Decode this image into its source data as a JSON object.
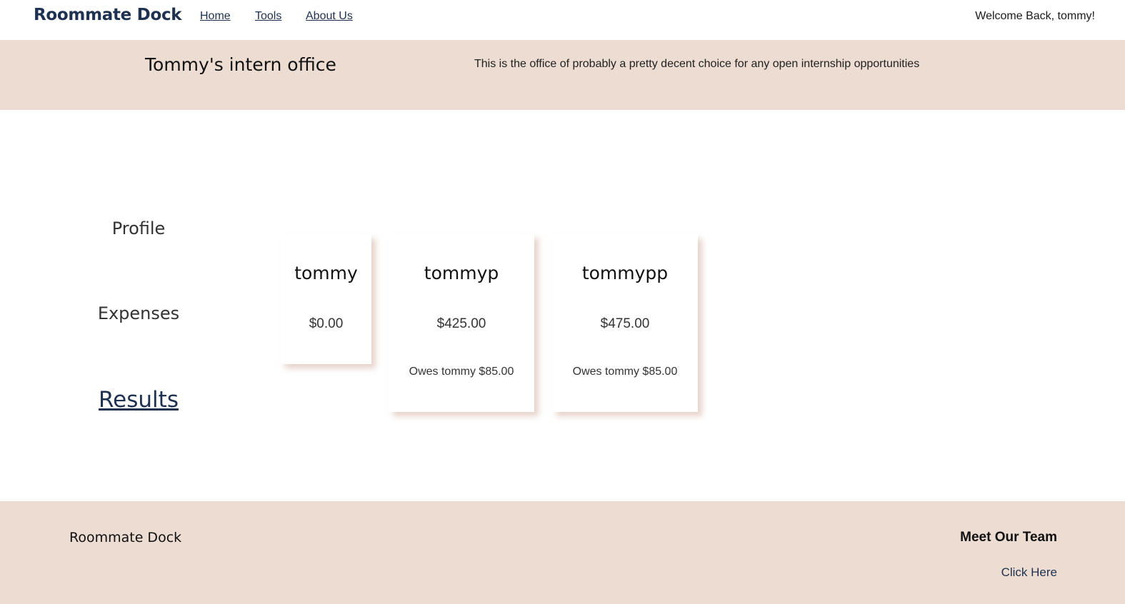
{
  "nav": {
    "brand": "Roommate Dock",
    "links": [
      {
        "label": "Home"
      },
      {
        "label": "Tools"
      },
      {
        "label": "About Us"
      }
    ],
    "welcome": "Welcome Back, tommy!"
  },
  "banner": {
    "title": "Tommy's intern office",
    "description": "This is the office of probably a pretty decent choice for any open internship opportunities"
  },
  "sidebar": {
    "items": [
      {
        "label": "Profile"
      },
      {
        "label": "Expenses"
      },
      {
        "label": "Results",
        "active": true
      }
    ]
  },
  "results": {
    "cards": [
      {
        "name": "tommy",
        "amount": "$0.00",
        "owes": ""
      },
      {
        "name": "tommyp",
        "amount": "$425.00",
        "owes": "Owes tommy $85.00"
      },
      {
        "name": "tommypp",
        "amount": "$475.00",
        "owes": "Owes tommy $85.00"
      }
    ]
  },
  "footer": {
    "brand": "Roommate Dock",
    "team_heading": "Meet Our Team",
    "team_link": "Click Here"
  },
  "colors": {
    "brand_navy": "#1f3150",
    "banner_bg": "#ecdcd2",
    "card_shadow": "#dec4b8"
  }
}
